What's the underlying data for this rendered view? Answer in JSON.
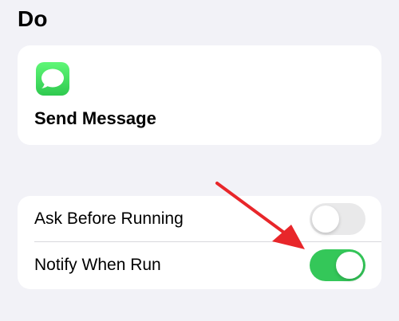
{
  "section": {
    "title": "Do"
  },
  "action": {
    "icon": "messages-app-icon",
    "label": "Send Message"
  },
  "settings": {
    "rows": [
      {
        "label": "Ask Before Running",
        "toggle_on": false
      },
      {
        "label": "Notify When Run",
        "toggle_on": true
      }
    ]
  },
  "annotation": {
    "icon": "red-arrow-icon",
    "color": "#e8262a"
  },
  "colors": {
    "background": "#f2f2f7",
    "card": "#ffffff",
    "toggle_on": "#34c759",
    "toggle_off": "#e9e9ea",
    "messages_green": "#34c759"
  }
}
